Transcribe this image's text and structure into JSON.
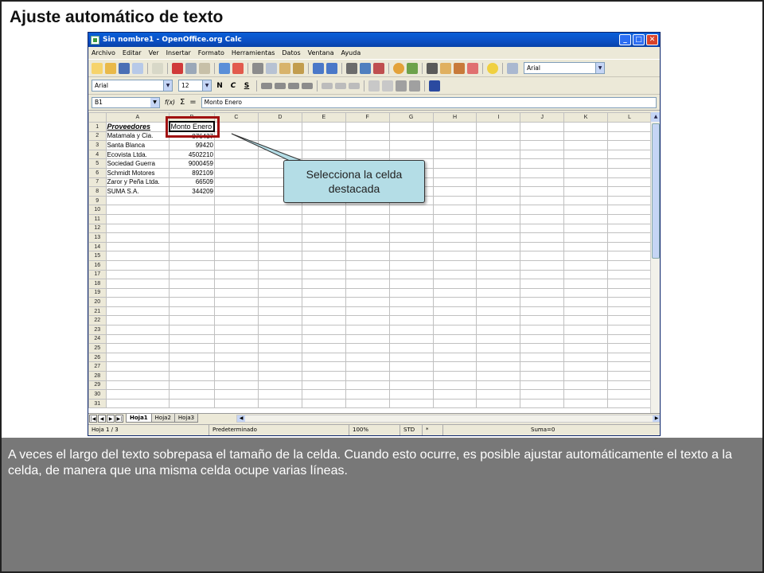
{
  "slide": {
    "title": "Ajuste automático de texto",
    "caption": "A veces el largo del texto sobrepasa el tamaño de la celda. Cuando esto ocurre, es posible ajustar automáticamente el texto a la celda, de manera que una misma celda ocupe varias líneas."
  },
  "window": {
    "title": "Sin nombre1 - OpenOffice.org Calc",
    "controls": [
      "_",
      "□",
      "✕"
    ]
  },
  "menu": [
    "Archivo",
    "Editar",
    "Ver",
    "Insertar",
    "Formato",
    "Herramientas",
    "Datos",
    "Ventana",
    "Ayuda"
  ],
  "toolbar": {
    "font_select": "Arial"
  },
  "format_bar": {
    "font_name": "Arial",
    "font_size": "12",
    "bold": "N",
    "italic": "C",
    "underline": "S"
  },
  "formula_bar": {
    "cell_ref": "B1",
    "fx": "f(x)",
    "sigma": "Σ",
    "equals": "=",
    "content": "Monto Enero"
  },
  "sheet": {
    "columns": [
      "A",
      "B",
      "C",
      "D",
      "E",
      "F",
      "G",
      "H",
      "I",
      "J",
      "K",
      "L"
    ],
    "rows": [
      {
        "n": "1",
        "a": "Proveedores",
        "b": "Monto Enero"
      },
      {
        "n": "2",
        "a": "Matamala y Cia.",
        "b": "876437"
      },
      {
        "n": "3",
        "a": "Santa Blanca",
        "b": "99420"
      },
      {
        "n": "4",
        "a": "Ecovista Ltda.",
        "b": "4502210"
      },
      {
        "n": "5",
        "a": "Sociedad Guerra",
        "b": "9000459"
      },
      {
        "n": "6",
        "a": "Schmidt Motores",
        "b": "892109"
      },
      {
        "n": "7",
        "a": "Zaror y Peña Ltda.",
        "b": "66509"
      },
      {
        "n": "8",
        "a": "SUMA S.A.",
        "b": "344209"
      },
      {
        "n": "9",
        "a": "",
        "b": ""
      },
      {
        "n": "10",
        "a": "",
        "b": ""
      },
      {
        "n": "11",
        "a": "",
        "b": ""
      },
      {
        "n": "12",
        "a": "",
        "b": ""
      },
      {
        "n": "13",
        "a": "",
        "b": ""
      },
      {
        "n": "14",
        "a": "",
        "b": ""
      },
      {
        "n": "15",
        "a": "",
        "b": ""
      },
      {
        "n": "16",
        "a": "",
        "b": ""
      },
      {
        "n": "17",
        "a": "",
        "b": ""
      },
      {
        "n": "18",
        "a": "",
        "b": ""
      },
      {
        "n": "19",
        "a": "",
        "b": ""
      },
      {
        "n": "20",
        "a": "",
        "b": ""
      },
      {
        "n": "21",
        "a": "",
        "b": ""
      },
      {
        "n": "22",
        "a": "",
        "b": ""
      },
      {
        "n": "23",
        "a": "",
        "b": ""
      },
      {
        "n": "24",
        "a": "",
        "b": ""
      },
      {
        "n": "25",
        "a": "",
        "b": ""
      },
      {
        "n": "26",
        "a": "",
        "b": ""
      },
      {
        "n": "27",
        "a": "",
        "b": ""
      },
      {
        "n": "28",
        "a": "",
        "b": ""
      },
      {
        "n": "29",
        "a": "",
        "b": ""
      },
      {
        "n": "30",
        "a": "",
        "b": ""
      },
      {
        "n": "31",
        "a": "",
        "b": ""
      }
    ]
  },
  "tabs": [
    "Hoja1",
    "Hoja2",
    "Hoja3"
  ],
  "status": {
    "sheet": "Hoja 1 / 3",
    "style": "Predeterminado",
    "zoom": "100%",
    "mode": "STD",
    "modified": "*",
    "sum": "Suma=0"
  },
  "callout": {
    "text": "Selecciona la celda destacada"
  }
}
